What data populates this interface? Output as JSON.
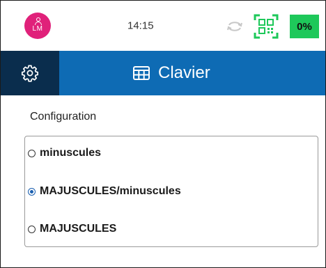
{
  "status_bar": {
    "avatar_initials": "LM",
    "time": "14:15",
    "battery_text": "0%",
    "icons": [
      "person-icon",
      "sync-icon",
      "qr-code-icon"
    ]
  },
  "header": {
    "title": "Clavier",
    "settings_icon": "gear-icon",
    "title_icon": "keyboard-icon"
  },
  "configuration": {
    "label": "Configuration",
    "options": [
      {
        "label": "minuscules",
        "checked": false
      },
      {
        "label": "MAJUSCULES/minuscules",
        "checked": true
      },
      {
        "label": "MAJUSCULES",
        "checked": false
      }
    ]
  },
  "colors": {
    "avatar": "#e0217a",
    "header": "#0e6bb4",
    "settings_bg": "#0a2d4d",
    "battery": "#1ec85a",
    "qr": "#1ec85a"
  }
}
